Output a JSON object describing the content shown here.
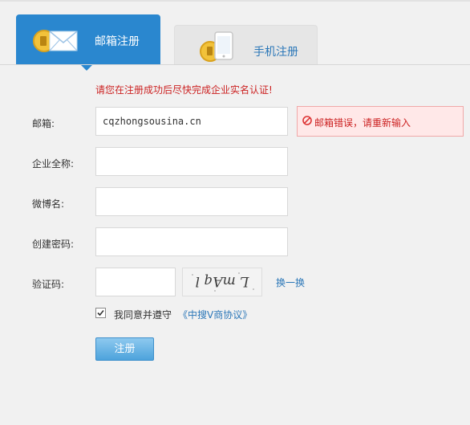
{
  "tabs": {
    "email_label": "邮箱注册",
    "phone_label": "手机注册"
  },
  "notice": "请您在注册成功后尽快完成企业实名认证!",
  "fields": {
    "email": {
      "label": "邮箱:",
      "value": "cqzhongsousina.cn"
    },
    "company": {
      "label": "企业全称:",
      "value": ""
    },
    "weibo": {
      "label": "微博名:",
      "value": ""
    },
    "password": {
      "label": "创建密码:",
      "value": ""
    },
    "captcha": {
      "label": "验证码:",
      "value": "",
      "image_text": "L mAq l",
      "refresh_label": "换一换"
    }
  },
  "error": {
    "text": "邮箱错误，请重新输入"
  },
  "agreement": {
    "checked": true,
    "text": "我同意并遵守",
    "link": "《中搜V商协议》"
  },
  "submit_label": "注册",
  "colors": {
    "tab_active": "#2a87cf",
    "link": "#2b77b8",
    "error": "#cc2222"
  },
  "icons": {
    "email_tab": "envelope-coin-icon",
    "phone_tab": "phone-coin-icon",
    "error": "no-entry-icon",
    "checkbox": "check-icon"
  }
}
